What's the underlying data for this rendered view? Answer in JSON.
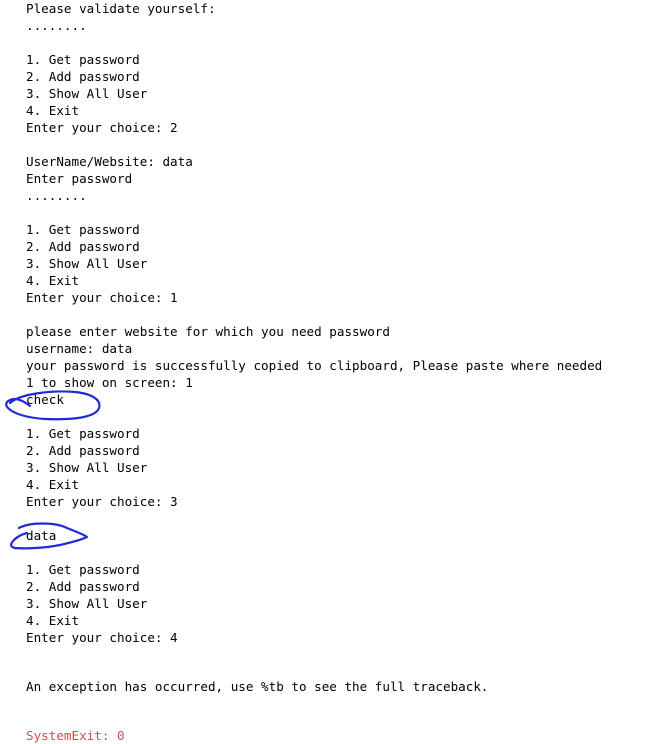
{
  "output": {
    "validate_prompt": "Please validate yourself:",
    "masked_1": "........",
    "menu_1": [
      "1. Get password",
      "2. Add password",
      "3. Show All User",
      "4. Exit"
    ],
    "choice_1": "Enter your choice: 2",
    "username_website": "UserName/Website: data",
    "enter_password": "Enter password",
    "masked_2": "........",
    "menu_2": [
      "1. Get password",
      "2. Add password",
      "3. Show All User",
      "4. Exit"
    ],
    "choice_2": "Enter your choice: 1",
    "website_prompt": "please enter website for which you need password",
    "username": "username: data",
    "copied_message": "your password is successfully copied to clipboard, Please paste where needed",
    "show_on_screen": "1 to show on screen: 1",
    "check": "check",
    "menu_3": [
      "1. Get password",
      "2. Add password",
      "3. Show All User",
      "4. Exit"
    ],
    "choice_3": "Enter your choice: 3",
    "user_listed": "data",
    "menu_4": [
      "1. Get password",
      "2. Add password",
      "3. Show All User",
      "4. Exit"
    ],
    "choice_4": "Enter your choice: 4",
    "exception": "An exception has occurred, use %tb to see the full traceback.",
    "cut_line": "SystemExit: 0"
  },
  "annotation_color": "#1f2bd6"
}
